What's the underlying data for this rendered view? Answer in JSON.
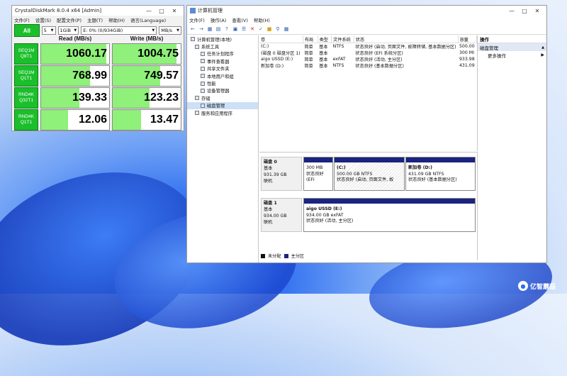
{
  "cdm": {
    "title": "CrystalDiskMark 8.0.4 x64 [Admin]",
    "menu": [
      "文件(F)",
      "设置(S)",
      "配置文件(P)",
      "主题(T)",
      "帮助(H)",
      "语言(Language)"
    ],
    "all_label": "All",
    "count": "5",
    "size": "1GiB",
    "drive": "E: 0% (0/934GiB)",
    "unit": "MB/s",
    "read_header": "Read (MB/s)",
    "write_header": "Write (MB/s)",
    "tests": [
      {
        "l1": "SEQ1M",
        "l2": "Q8T1",
        "read": "1060.17",
        "write": "1004.75"
      },
      {
        "l1": "SEQ1M",
        "l2": "Q1T1",
        "read": "768.99",
        "write": "749.57"
      },
      {
        "l1": "RND4K",
        "l2": "Q32T1",
        "read": "139.33",
        "write": "123.23"
      },
      {
        "l1": "RND4K",
        "l2": "Q1T1",
        "read": "12.06",
        "write": "13.47"
      }
    ],
    "fills": {
      "read": [
        0.96,
        0.72,
        0.56,
        0.4
      ],
      "write": [
        0.94,
        0.7,
        0.54,
        0.42
      ]
    },
    "accent": "#1bbf2b"
  },
  "dm": {
    "title": "计算机管理",
    "menu": [
      "文件(F)",
      "操作(A)",
      "查看(V)",
      "帮助(H)"
    ],
    "tree": [
      "计算机管理(本地)",
      "系统工具",
      "任务计划程序",
      "事件查看器",
      "共享文件夹",
      "本地用户和组",
      "性能",
      "设备管理器",
      "存储",
      "磁盘管理",
      "服务和应用程序"
    ],
    "columns": [
      "卷",
      "布局",
      "类型",
      "文件系统",
      "状态",
      "容量"
    ],
    "volumes": [
      [
        "(C:)",
        "简单",
        "基本",
        "NTFS",
        "状态良好 (启动, 页面文件, 故障转储, 基本数据分区)",
        "500.00"
      ],
      [
        "(磁盘 0 磁盘分区 1)",
        "简单",
        "基本",
        "",
        "状态良好 (EFI 系统分区)",
        "300 MI"
      ],
      [
        "aigo USSD (E:)",
        "简单",
        "基本",
        "exFAT",
        "状态良好 (活动, 主分区)",
        "933.98"
      ],
      [
        "新加卷 (D:)",
        "简单",
        "基本",
        "NTFS",
        "状态良好 (基本数据分区)",
        "431.09"
      ]
    ],
    "disk0": {
      "name": "磁盘 0",
      "type": "基本",
      "size": "931.39 GB",
      "status": "联机"
    },
    "disk0_parts": [
      {
        "title": "",
        "l1": "300 MB",
        "l2": "状态良好 (EFI"
      },
      {
        "title": "(C:)",
        "l1": "500.00 GB NTFS",
        "l2": "状态良好 (启动, 页面文件, 故"
      },
      {
        "title": "新加卷  (D:)",
        "l1": "431.09 GB NTFS",
        "l2": "状态良好 (基本数据分区)"
      }
    ],
    "disk1": {
      "name": "磁盘 1",
      "type": "基本",
      "size": "934.00 GB",
      "status": "联机"
    },
    "disk1_part": {
      "title": "aigo USSD  (E:)",
      "l1": "934.00 GB exFAT",
      "l2": "状态良好 (活动, 主分区)"
    },
    "legend_unalloc": "未分配",
    "legend_primary": "主分区",
    "actions_header": "操作",
    "actions_section": "磁盘管理",
    "actions_more": "更多操作",
    "accent": "#1a237e"
  },
  "watermark": "亿智蘑菇"
}
